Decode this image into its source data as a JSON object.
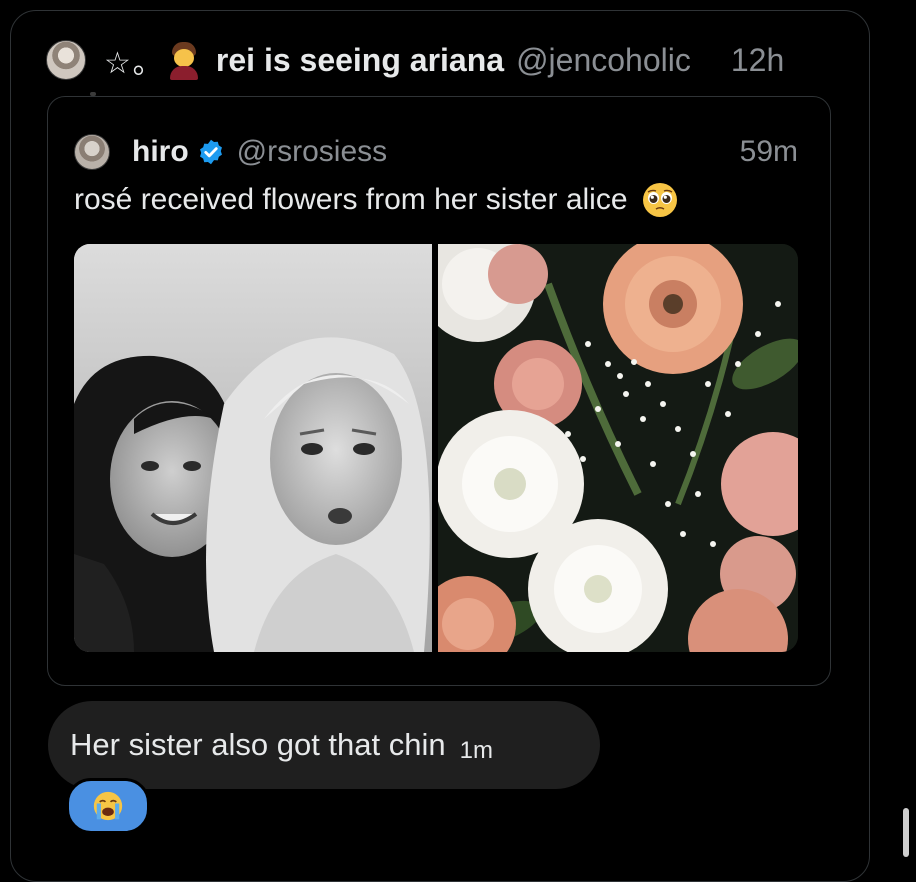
{
  "outer_post": {
    "star_text": "☆｡",
    "display_name": "rei is seeing ariana",
    "handle": "@jencoholic",
    "time": "12h"
  },
  "quoted_post": {
    "display_name": "hiro",
    "handle": "@rsrosiess",
    "time": "59m",
    "text": "rosé received flowers from her sister alice",
    "verified_color": "#1d9bf0",
    "emoji": "pleading-face"
  },
  "comment": {
    "text": "Her sister also got that chin",
    "time": "1m",
    "reaction_emoji": "loudly-crying-face",
    "reaction_color": "#4a90e2"
  },
  "colors": {
    "background": "#000000",
    "text_primary": "#e7e9ea",
    "text_secondary": "#8b8f94",
    "border": "#2f3336",
    "bubble": "#1f1f1f"
  }
}
